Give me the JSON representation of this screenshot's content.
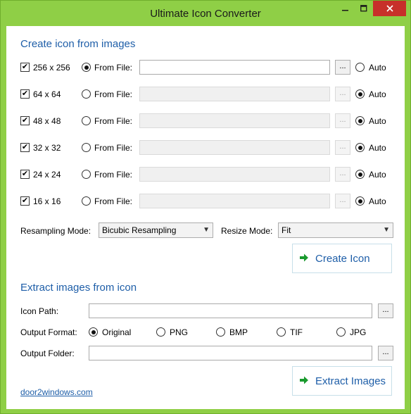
{
  "window": {
    "title": "Ultimate Icon Converter",
    "minimize_icon": "minimize-icon",
    "maximize_icon": "maximize-icon",
    "close_icon": "close-icon"
  },
  "create": {
    "section_title": "Create icon from images",
    "from_file_label": "From File:",
    "auto_label": "Auto",
    "browse_label": "...",
    "rows": [
      {
        "size": "256 x 256",
        "checked": true,
        "from_file_selected": true
      },
      {
        "size": "64 x 64",
        "checked": true,
        "from_file_selected": false
      },
      {
        "size": "48 x 48",
        "checked": true,
        "from_file_selected": false
      },
      {
        "size": "32 x 32",
        "checked": true,
        "from_file_selected": false
      },
      {
        "size": "24 x 24",
        "checked": true,
        "from_file_selected": false
      },
      {
        "size": "16 x 16",
        "checked": true,
        "from_file_selected": false
      }
    ],
    "resampling_label": "Resampling Mode:",
    "resampling_value": "Bicubic Resampling",
    "resize_label": "Resize Mode:",
    "resize_value": "Fit",
    "create_button": "Create Icon"
  },
  "extract": {
    "section_title": "Extract images from icon",
    "icon_path_label": "Icon Path:",
    "output_format_label": "Output Format:",
    "formats": [
      "Original",
      "PNG",
      "BMP",
      "TIF",
      "JPG"
    ],
    "selected_format": "Original",
    "output_folder_label": "Output Folder:",
    "browse_label": "...",
    "extract_button": "Extract Images"
  },
  "footer": {
    "link": "door2windows.com"
  },
  "colors": {
    "accent": "#1e5ea8",
    "frame": "#8fcf46",
    "close": "#c7302a",
    "arrow": "#1a9a2e"
  }
}
